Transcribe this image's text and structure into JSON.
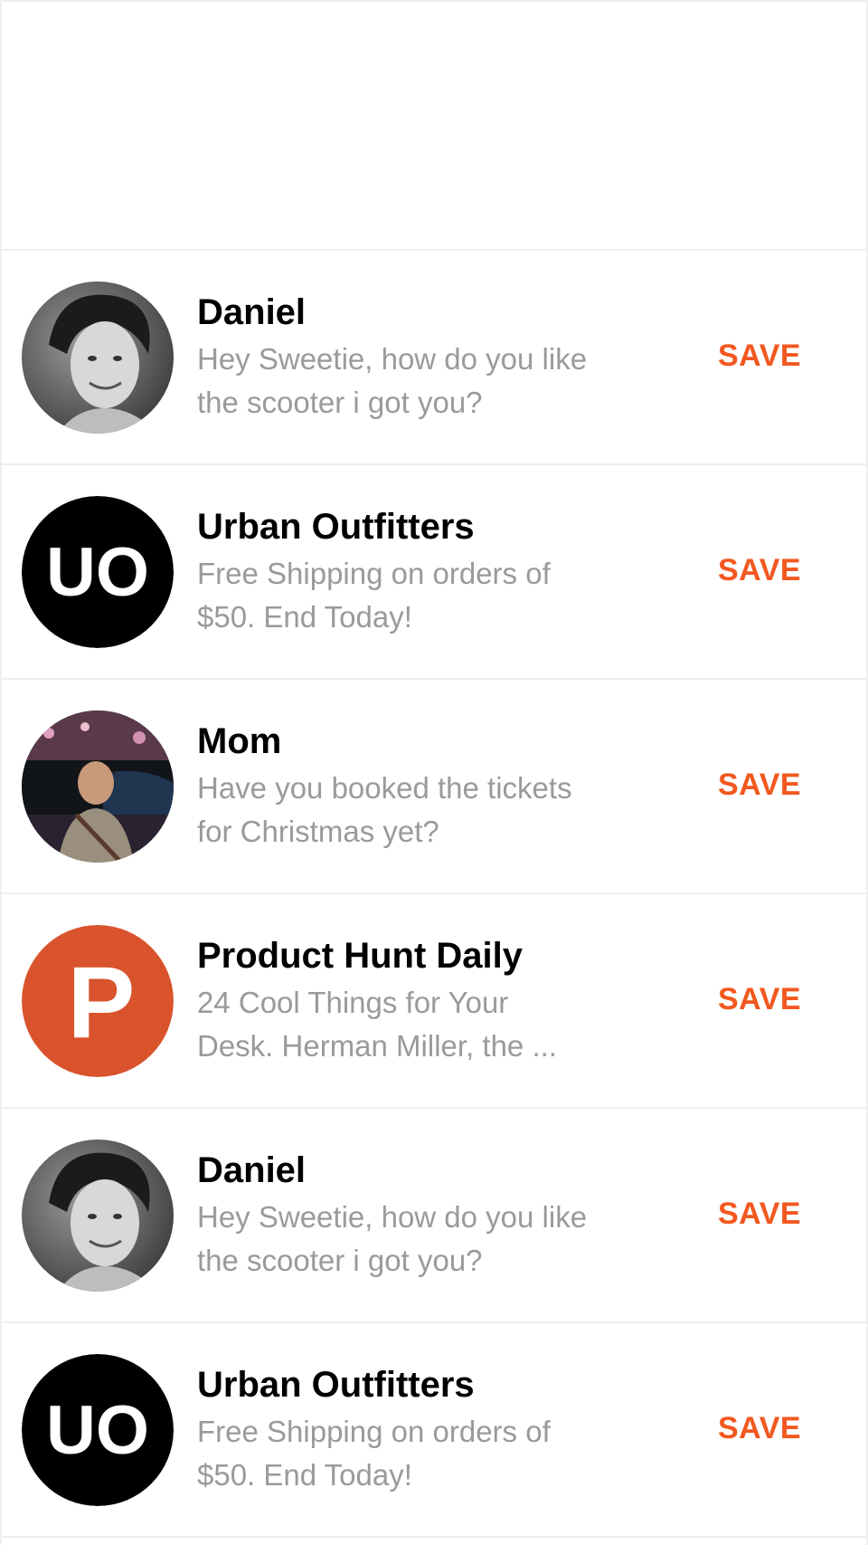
{
  "messages": [
    {
      "sender": "Daniel",
      "preview_line1": "Hey Sweetie, how do you like",
      "preview_line2": "the scooter i got you?",
      "action": "SAVE",
      "avatar": "photo-daniel"
    },
    {
      "sender": "Urban Outfitters",
      "preview_line1": "Free Shipping on orders of",
      "preview_line2": "$50. End Today!",
      "action": "SAVE",
      "avatar": "logo-uo",
      "logo_text": "UO"
    },
    {
      "sender": "Mom",
      "preview_line1": "Have you booked the tickets",
      "preview_line2": "for Christmas yet?",
      "action": "SAVE",
      "avatar": "photo-mom"
    },
    {
      "sender": "Product Hunt Daily",
      "preview_line1": "24 Cool Things for Your",
      "preview_line2": "Desk. Herman Miller, the ...",
      "action": "SAVE",
      "avatar": "logo-producthunt",
      "logo_text": "P"
    },
    {
      "sender": "Daniel",
      "preview_line1": "Hey Sweetie, how do you like",
      "preview_line2": "the scooter i got you?",
      "action": "SAVE",
      "avatar": "photo-daniel"
    },
    {
      "sender": "Urban Outfitters",
      "preview_line1": "Free Shipping on orders of",
      "preview_line2": "$50. End Today!",
      "action": "SAVE",
      "avatar": "logo-uo",
      "logo_text": "UO"
    }
  ],
  "colors": {
    "accent": "#f2581f",
    "sender_text": "#000000",
    "preview_text": "#9a9a9a",
    "divider": "#eeeeee",
    "producthunt": "#d9532c",
    "uo_background": "#000000"
  }
}
